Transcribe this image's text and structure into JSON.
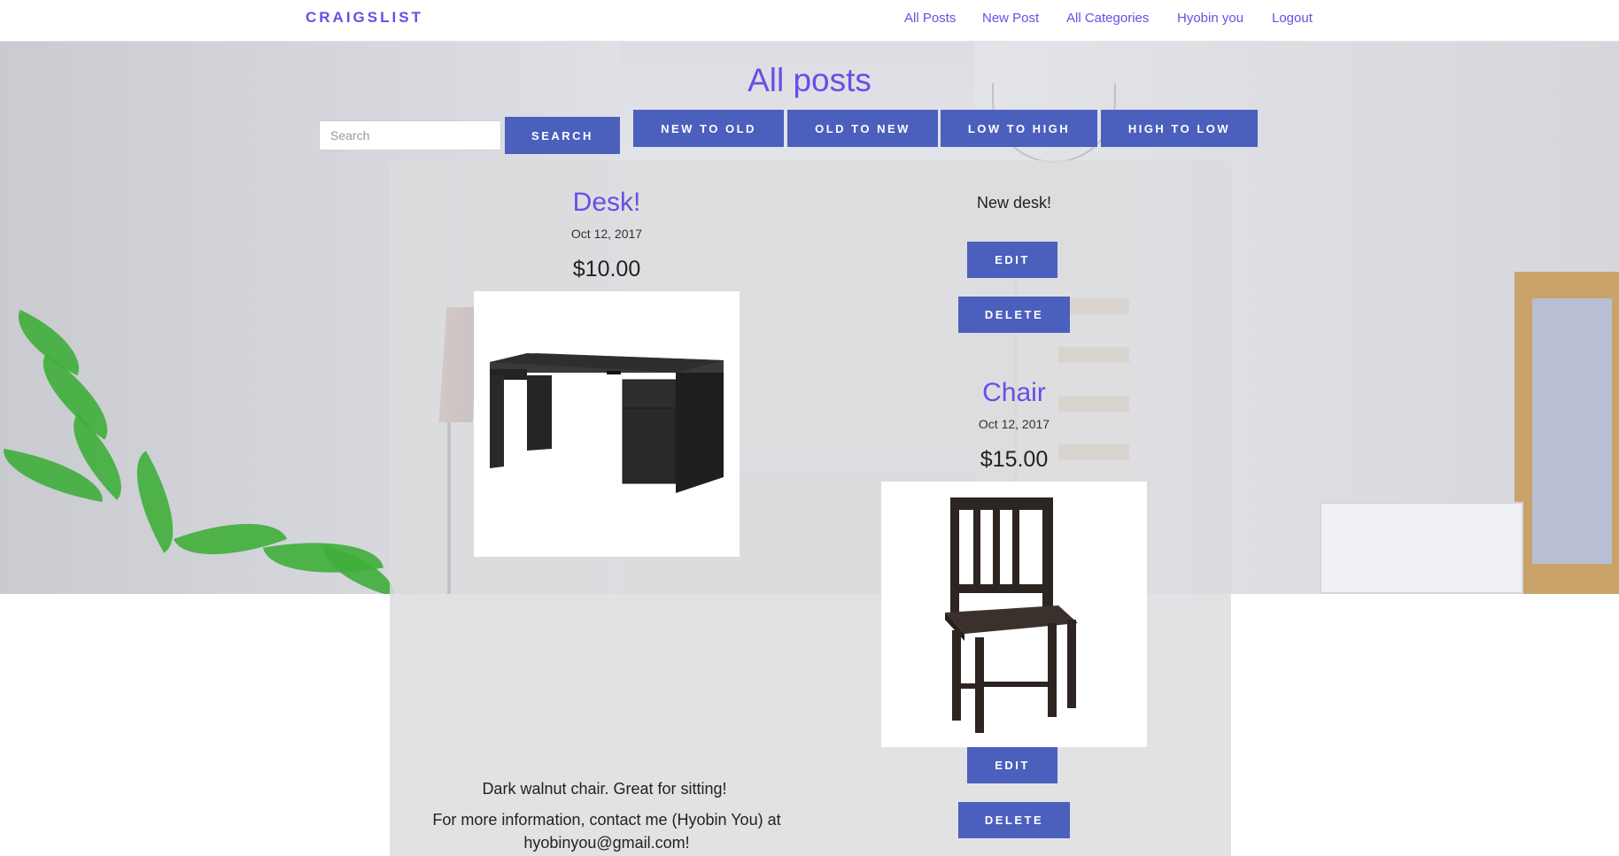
{
  "navbar": {
    "brand": "CRAIGSLIST",
    "links": [
      "All Posts",
      "New Post",
      "All Categories",
      "Hyobin you",
      "Logout"
    ]
  },
  "page": {
    "title": "All posts"
  },
  "search": {
    "placeholder": "Search",
    "button_label": "SEARCH"
  },
  "sort_buttons": [
    "NEW TO OLD",
    "OLD TO NEW",
    "LOW TO HIGH",
    "HIGH TO LOW"
  ],
  "posts": [
    {
      "title": "Desk!",
      "date": "Oct 12, 2017",
      "price": "$10.00",
      "description": "New desk!",
      "image": "desk-image",
      "edit_label": "EDIT",
      "delete_label": "DELETE"
    },
    {
      "title": "Chair",
      "date": "Oct 12, 2017",
      "price": "$15.00",
      "description": "Dark walnut chair. Great for sitting!",
      "contact": "For more information, contact me (Hyobin You) at hyobinyou@gmail.com!",
      "image": "chair-image",
      "edit_label": "EDIT",
      "delete_label": "DELETE"
    }
  ],
  "colors": {
    "accent": "#6a4de6",
    "button": "#4b5fbd"
  }
}
